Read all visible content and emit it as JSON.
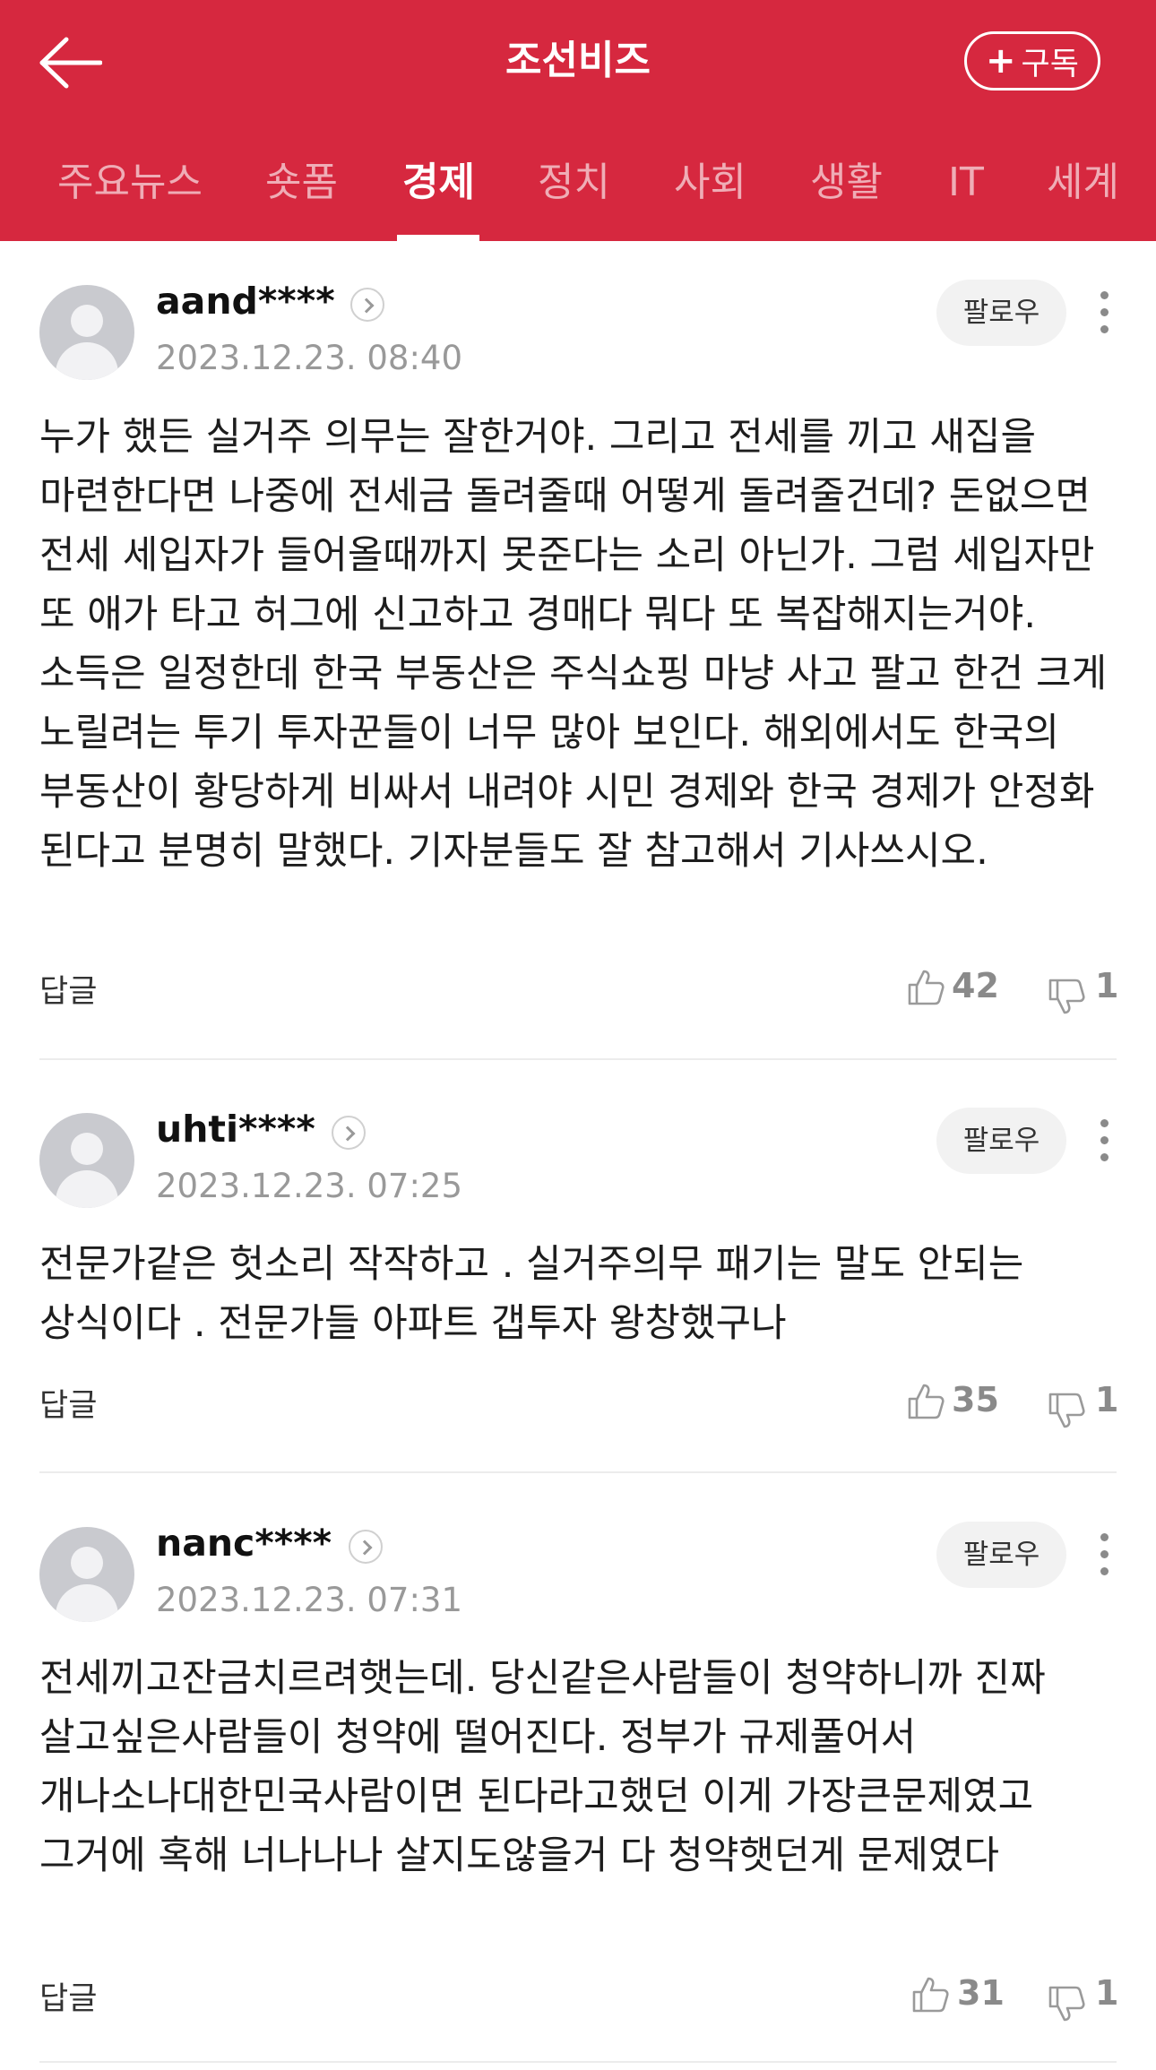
{
  "header": {
    "title": "조선비즈",
    "subscribe_label": "구독"
  },
  "tabs": [
    {
      "label": "주요뉴스"
    },
    {
      "label": "숏폼"
    },
    {
      "label": "경제"
    },
    {
      "label": "정치"
    },
    {
      "label": "사회"
    },
    {
      "label": "생활"
    },
    {
      "label": "IT"
    },
    {
      "label": "세계"
    }
  ],
  "active_tab": "경제",
  "comments": [
    {
      "username": "aand****",
      "date": "2023.12.23. 08:40",
      "follow_label": "팔로우",
      "text": "누가 했든 실거주 의무는 잘한거야. 그리고 전세를 끼고 새집을 마련한다면 나중에 전세금 돌려줄때 어떻게 돌려줄건데? 돈없으면 전세 세입자가 들어올때까지 못준다는 소리 아닌가. 그럼 세입자만 또 애가 타고 허그에 신고하고 경매다 뭐다 또 복잡해지는거야. 소득은 일정한데 한국 부동산은 주식쇼핑 마냥 사고 팔고 한건 크게 노릴려는 투기 투자꾼들이 너무 많아 보인다. 해외에서도 한국의 부동산이 황당하게 비싸서 내려야 시민 경제와 한국 경제가 안정화 된다고 분명히 말했다. 기자분들도 잘 참고해서 기사쓰시오.",
      "reply_label": "답글",
      "likes": "42",
      "dislikes": "1"
    },
    {
      "username": "uhti****",
      "date": "2023.12.23. 07:25",
      "follow_label": "팔로우",
      "text": "전문가같은 헛소리 작작하고 . 실거주의무 패기는 말도 안되는 상식이다 . 전문가들 아파트 갭투자 왕창했구나",
      "reply_label": "답글",
      "likes": "35",
      "dislikes": "1"
    },
    {
      "username": "nanc****",
      "date": "2023.12.23. 07:31",
      "follow_label": "팔로우",
      "text": "전세끼고잔금치르려햇는데. 당신같은사람들이 청약하니까 진짜 살고싶은사람들이 청약에 떨어진다. 정부가 규제풀어서 개나소나대한민국사람이면 된다라고했던 이게 가장큰문제였고 그거에 혹해 너나나나 살지도않을거 다 청약햇던게 문제였다",
      "reply_label": "답글",
      "likes": "31",
      "dislikes": "1"
    }
  ],
  "colors": {
    "brand": "#d6283f",
    "muted": "#999999"
  }
}
